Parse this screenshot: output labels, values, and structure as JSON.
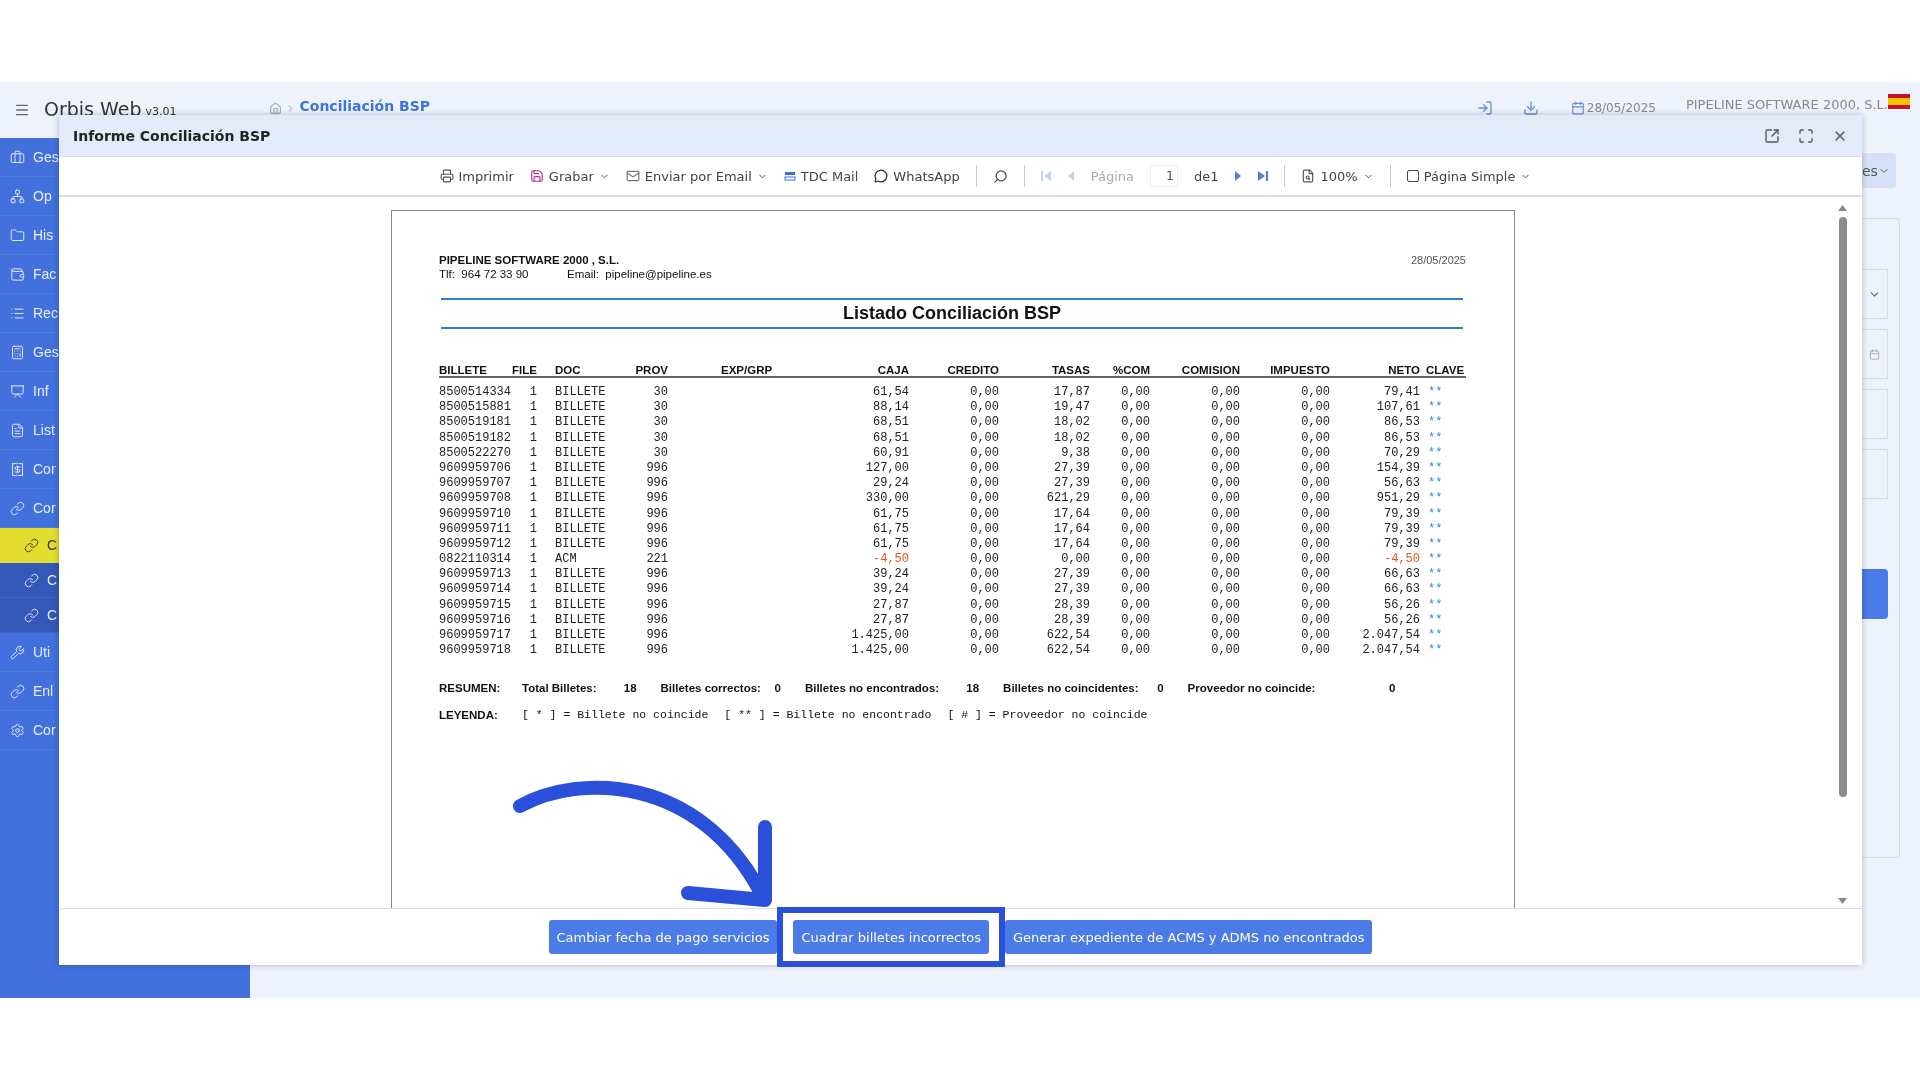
{
  "app": {
    "name": "Orbis Web",
    "version": "v3.01",
    "breadcrumb": "Conciliación BSP",
    "date": "28/05/2025",
    "company": "PIPELINE SOFTWARE 2000, S.L."
  },
  "sidebar": {
    "items": [
      {
        "label": "Ges",
        "selected": false,
        "sub": false
      },
      {
        "label": "Op",
        "selected": false,
        "sub": false
      },
      {
        "label": "His",
        "selected": false,
        "sub": false
      },
      {
        "label": "Fac",
        "selected": false,
        "sub": false
      },
      {
        "label": "Rec",
        "selected": false,
        "sub": false
      },
      {
        "label": "Ges",
        "selected": false,
        "sub": false
      },
      {
        "label": "Inf",
        "selected": false,
        "sub": false
      },
      {
        "label": "List",
        "selected": false,
        "sub": false
      },
      {
        "label": "Cor",
        "selected": false,
        "sub": false
      },
      {
        "label": "Cor",
        "selected": false,
        "sub": false
      },
      {
        "label": "C",
        "selected": true,
        "sub": true
      },
      {
        "label": "C",
        "selected": false,
        "sub": true
      },
      {
        "label": "C",
        "selected": false,
        "sub": true
      },
      {
        "label": "Uti",
        "selected": false,
        "sub": false
      },
      {
        "label": "Enl",
        "selected": false,
        "sub": false
      },
      {
        "label": "Cor",
        "selected": false,
        "sub": false
      }
    ]
  },
  "background_panel": {
    "button": "es"
  },
  "dialog": {
    "title": "Informe Conciliación BSP",
    "toolbar": [
      {
        "kind": "action",
        "label": "Imprimir",
        "dropdown": false
      },
      {
        "kind": "action",
        "label": "Grabar",
        "dropdown": true
      },
      {
        "kind": "action",
        "label": "Enviar por Email",
        "dropdown": true
      },
      {
        "kind": "action",
        "label": "TDC Mail",
        "dropdown": false
      },
      {
        "kind": "action",
        "label": "WhatsApp",
        "dropdown": false
      },
      {
        "kind": "separator"
      },
      {
        "kind": "icon"
      },
      {
        "kind": "separator"
      },
      {
        "kind": "icon",
        "disabled": true
      },
      {
        "kind": "icon",
        "disabled": true
      },
      {
        "kind": "label",
        "label": "Página",
        "disabled": true
      },
      {
        "kind": "input",
        "value": "1"
      },
      {
        "kind": "label",
        "label": "de1",
        "disabled": false
      },
      {
        "kind": "icon",
        "disabled": false
      },
      {
        "kind": "icon",
        "disabled": false
      },
      {
        "kind": "separator"
      },
      {
        "kind": "action",
        "label": "100%",
        "dropdown": true
      },
      {
        "kind": "separator"
      },
      {
        "kind": "checkbox",
        "label": "Página Simple",
        "checked": false,
        "dropdown": true
      }
    ],
    "report": {
      "company": "PIPELINE SOFTWARE 2000 , S.L.",
      "phone": "Tlf:  964 72 33 90",
      "email": "Email:  pipeline@pipeline.es",
      "date": "28/05/2025",
      "title": "Listado Conciliación BSP",
      "columns": [
        "BILLETE",
        "FILE",
        "DOC",
        "PROV",
        "EXP/GRP",
        "CAJA",
        "CREDITO",
        "TASAS",
        "%COM",
        "COMISION",
        "IMPUESTO",
        "NETO",
        "CLAVE"
      ],
      "rows": [
        {
          "cells": [
            "8500514334",
            "1",
            "BILLETE",
            "30",
            "",
            "61,54",
            "0,00",
            "17,87",
            "0,00",
            "0,00",
            "0,00",
            "79,41",
            "**"
          ],
          "negative": false
        },
        {
          "cells": [
            "8500515881",
            "1",
            "BILLETE",
            "30",
            "",
            "88,14",
            "0,00",
            "19,47",
            "0,00",
            "0,00",
            "0,00",
            "107,61",
            "**"
          ],
          "negative": false
        },
        {
          "cells": [
            "8500519181",
            "1",
            "BILLETE",
            "30",
            "",
            "68,51",
            "0,00",
            "18,02",
            "0,00",
            "0,00",
            "0,00",
            "86,53",
            "**"
          ],
          "negative": false
        },
        {
          "cells": [
            "8500519182",
            "1",
            "BILLETE",
            "30",
            "",
            "68,51",
            "0,00",
            "18,02",
            "0,00",
            "0,00",
            "0,00",
            "86,53",
            "**"
          ],
          "negative": false
        },
        {
          "cells": [
            "8500522270",
            "1",
            "BILLETE",
            "30",
            "",
            "60,91",
            "0,00",
            "9,38",
            "0,00",
            "0,00",
            "0,00",
            "70,29",
            "**"
          ],
          "negative": false
        },
        {
          "cells": [
            "9609959706",
            "1",
            "BILLETE",
            "996",
            "",
            "127,00",
            "0,00",
            "27,39",
            "0,00",
            "0,00",
            "0,00",
            "154,39",
            "**"
          ],
          "negative": false
        },
        {
          "cells": [
            "9609959707",
            "1",
            "BILLETE",
            "996",
            "",
            "29,24",
            "0,00",
            "27,39",
            "0,00",
            "0,00",
            "0,00",
            "56,63",
            "**"
          ],
          "negative": false
        },
        {
          "cells": [
            "9609959708",
            "1",
            "BILLETE",
            "996",
            "",
            "330,00",
            "0,00",
            "621,29",
            "0,00",
            "0,00",
            "0,00",
            "951,29",
            "**"
          ],
          "negative": false
        },
        {
          "cells": [
            "9609959710",
            "1",
            "BILLETE",
            "996",
            "",
            "61,75",
            "0,00",
            "17,64",
            "0,00",
            "0,00",
            "0,00",
            "79,39",
            "**"
          ],
          "negative": false
        },
        {
          "cells": [
            "9609959711",
            "1",
            "BILLETE",
            "996",
            "",
            "61,75",
            "0,00",
            "17,64",
            "0,00",
            "0,00",
            "0,00",
            "79,39",
            "**"
          ],
          "negative": false
        },
        {
          "cells": [
            "9609959712",
            "1",
            "BILLETE",
            "996",
            "",
            "61,75",
            "0,00",
            "17,64",
            "0,00",
            "0,00",
            "0,00",
            "79,39",
            "**"
          ],
          "negative": false
        },
        {
          "cells": [
            "0822110314",
            "1",
            "ACM",
            "221",
            "",
            "-4,50",
            "0,00",
            "0,00",
            "0,00",
            "0,00",
            "0,00",
            "-4,50",
            "**"
          ],
          "negative": true
        },
        {
          "cells": [
            "9609959713",
            "1",
            "BILLETE",
            "996",
            "",
            "39,24",
            "0,00",
            "27,39",
            "0,00",
            "0,00",
            "0,00",
            "66,63",
            "**"
          ],
          "negative": false
        },
        {
          "cells": [
            "9609959714",
            "1",
            "BILLETE",
            "996",
            "",
            "39,24",
            "0,00",
            "27,39",
            "0,00",
            "0,00",
            "0,00",
            "66,63",
            "**"
          ],
          "negative": false
        },
        {
          "cells": [
            "9609959715",
            "1",
            "BILLETE",
            "996",
            "",
            "27,87",
            "0,00",
            "28,39",
            "0,00",
            "0,00",
            "0,00",
            "56,26",
            "**"
          ],
          "negative": false
        },
        {
          "cells": [
            "9609959716",
            "1",
            "BILLETE",
            "996",
            "",
            "27,87",
            "0,00",
            "28,39",
            "0,00",
            "0,00",
            "0,00",
            "56,26",
            "**"
          ],
          "negative": false
        },
        {
          "cells": [
            "9609959717",
            "1",
            "BILLETE",
            "996",
            "",
            "1.425,00",
            "0,00",
            "622,54",
            "0,00",
            "0,00",
            "0,00",
            "2.047,54",
            "**"
          ],
          "negative": false
        },
        {
          "cells": [
            "9609959718",
            "1",
            "BILLETE",
            "996",
            "",
            "1.425,00",
            "0,00",
            "622,54",
            "0,00",
            "0,00",
            "0,00",
            "2.047,54",
            "**"
          ],
          "negative": false
        }
      ],
      "summary": {
        "title": "RESUMEN:",
        "items": [
          {
            "label": "Total Billetes:",
            "value": "18"
          },
          {
            "label": "Billetes correctos:",
            "value": "0"
          },
          {
            "label": "Billetes no encontrados:",
            "value": "18"
          },
          {
            "label": "Billetes no coincidentes:",
            "value": "0"
          },
          {
            "label": "Proveedor no coincide:",
            "value": "0"
          }
        ]
      },
      "legend": {
        "title": "LEYENDA:",
        "items": [
          "[ * ] = Billete no coincide",
          "[ ** ] = Billete no encontrado",
          "[ # ] = Proveedor no coincide"
        ]
      }
    },
    "buttons": [
      {
        "label": "Cambiar fecha de pago servicios",
        "highlighted": false
      },
      {
        "label": "Cuadrar billetes incorrectos",
        "highlighted": true
      },
      {
        "label": "Generar expediente de ACMS y ADMS no encontrados",
        "highlighted": false
      }
    ]
  }
}
